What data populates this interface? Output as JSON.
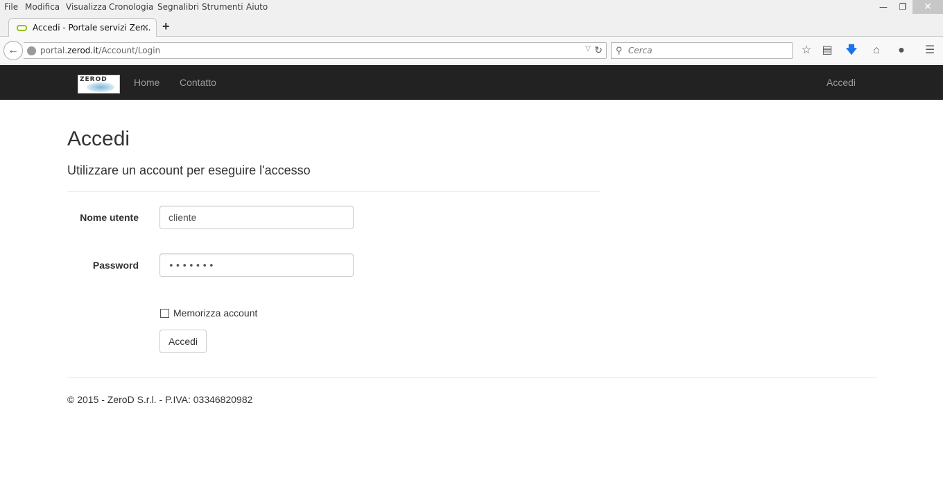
{
  "browser": {
    "menu": [
      "File",
      "Modifica",
      "Visualizza",
      "Cronologia",
      "Segnalibri",
      "Strumenti",
      "Aiuto"
    ],
    "window_controls": {
      "minimize": "—",
      "restore": "❐",
      "close": "✕"
    },
    "tab": {
      "title": "Accedi - Portale servizi Zer...",
      "close": "✕"
    },
    "new_tab": "+",
    "url": {
      "prefix": "portal.",
      "domain": "zerod.it",
      "path": "/Account/Login"
    },
    "search_placeholder": "Cerca",
    "icons": [
      "back-arrow-icon",
      "globe-icon",
      "dropdown-icon",
      "reload-icon",
      "search-icon",
      "star-icon",
      "reading-list-icon",
      "download-icon",
      "home-icon",
      "chat-icon",
      "menu-icon"
    ],
    "colors": {
      "download_icon": "#1a73e8",
      "tab_favicon": "#92c01c"
    }
  },
  "site": {
    "logo_text": "ZEROD",
    "nav": {
      "home": "Home",
      "contact": "Contatto",
      "login": "Accedi"
    },
    "colors": {
      "navbar_bg": "#222222",
      "nav_link": "#9d9d9d"
    }
  },
  "page": {
    "title": "Accedi",
    "subtitle": "Utilizzare un account per eseguire l'accesso",
    "form": {
      "username_label": "Nome utente",
      "username_value": "cliente",
      "password_label": "Password",
      "password_value": "•••••••",
      "remember_label": "Memorizza account",
      "remember_checked": false,
      "submit_label": "Accedi"
    },
    "footer": "© 2015 - ZeroD S.r.l. - P.IVA: 03346820982"
  }
}
